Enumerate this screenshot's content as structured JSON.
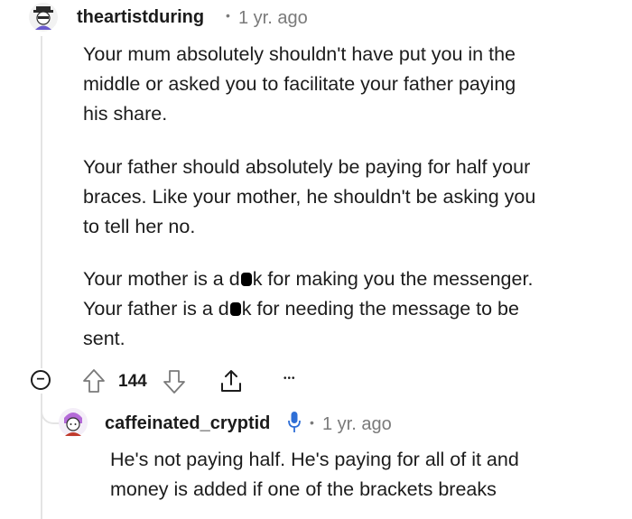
{
  "comment": {
    "username": "theartistduring",
    "dot": "•",
    "age": "1 yr. ago",
    "paragraphs": [
      [
        "Your mum absolutely shouldn't have put you in the",
        "middle or asked you to facilitate your father paying",
        "his share."
      ],
      [
        "Your father should absolutely be paying for half your",
        "braces. Like your mother, he shouldn't be asking you",
        "to tell her no."
      ]
    ],
    "p3": {
      "l1_a": "Your mother is a d",
      "l1_b": "k for making you the messenger.",
      "l2_a": "Your father is a d",
      "l2_b": "k for needing the message to be",
      "l3": "sent."
    },
    "actions": {
      "collapse_symbol": "−",
      "upvote_count": "144",
      "more": "•••"
    }
  },
  "reply": {
    "username": "caffeinated_cryptid",
    "dot": "•",
    "age": "1 yr. ago",
    "lines": [
      "He's not paying half. He's paying for all of it and",
      "money is added if one of the brackets breaks"
    ]
  },
  "colors": {
    "text": "#1c1c1c",
    "meta": "#7a7a7a",
    "thread": "#e4e4e4",
    "mic": "#2f6fd6"
  }
}
